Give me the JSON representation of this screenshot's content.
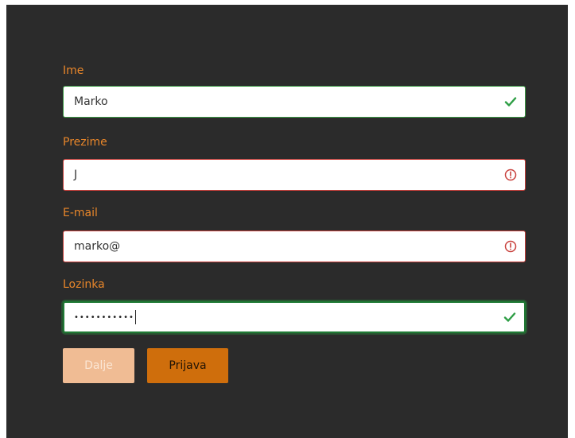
{
  "form": {
    "fields": [
      {
        "label": "Ime",
        "value": "Marko",
        "status": "valid"
      },
      {
        "label": "Prezime",
        "value": "J",
        "status": "invalid"
      },
      {
        "label": "E-mail",
        "value": "marko@",
        "status": "invalid"
      },
      {
        "label": "Lozinka",
        "value": "•••••••••••",
        "status": "valid",
        "masked": true,
        "focused": true
      }
    ],
    "buttons": {
      "next_label": "Dalje",
      "next_disabled": true,
      "login_label": "Prijava"
    }
  },
  "icons": {
    "valid": "check-icon",
    "invalid": "exclamation-circle-icon"
  },
  "colors": {
    "background": "#2b2b2b",
    "label": "#e8862a",
    "valid": "#2e9e45",
    "invalid": "#c8403c",
    "primary_button": "#cf6e0c",
    "disabled_button": "#f0bc94"
  }
}
